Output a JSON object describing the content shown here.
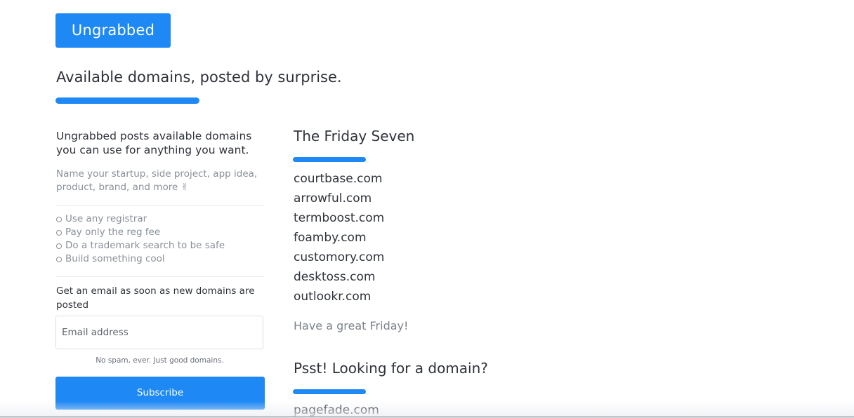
{
  "header": {
    "logo_label": "Ungrabbed",
    "tagline": "Available domains, posted by surprise."
  },
  "sidebar": {
    "intro": "Ungrabbed posts available domains you can use for anything you want.",
    "sub_intro": "Name your startup, side project, app idea, product, brand, and more ✌",
    "tips": [
      "Use any registrar",
      "Pay only the reg fee",
      "Do a trademark search to be safe",
      "Build something cool"
    ],
    "email_prompt": "Get an email as soon as new domains are posted",
    "email_placeholder": "Email address",
    "no_spam": "No spam, ever. Just good domains.",
    "subscribe_label": "Subscribe"
  },
  "main": {
    "post_title": "The Friday Seven",
    "domains": [
      "courtbase.com",
      "arrowful.com",
      "termboost.com",
      "foamby.com",
      "customory.com",
      "desktoss.com",
      "outlookr.com"
    ],
    "signoff": "Have a great Friday!",
    "promo_title": "Psst! Looking for a domain?",
    "promo_domain": "pagefade.com"
  },
  "colors": {
    "accent": "#1e88f5",
    "text": "#2f333a",
    "muted": "#8a9099"
  }
}
